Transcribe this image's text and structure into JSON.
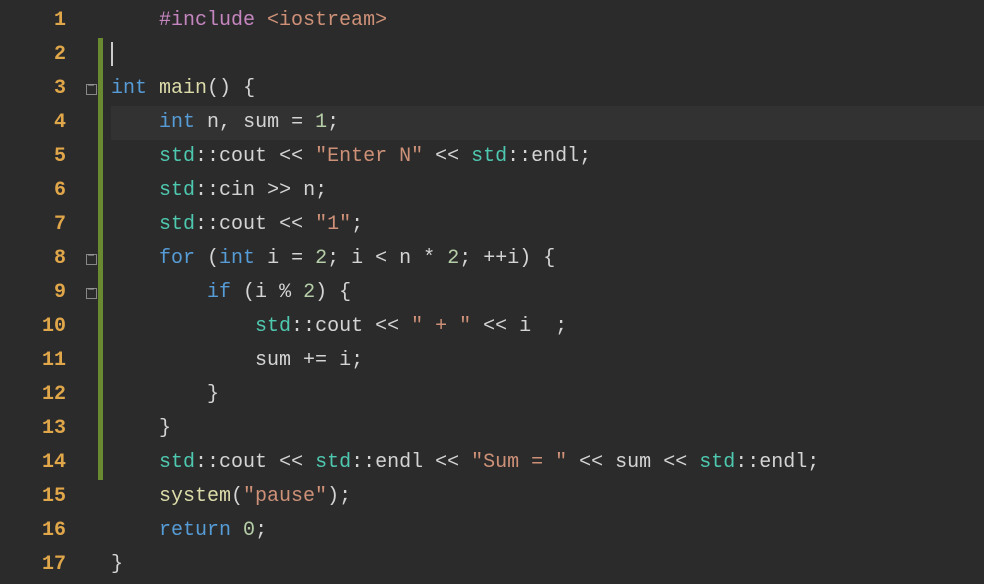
{
  "lines": {
    "n1": "1",
    "n2": "2",
    "n3": "3",
    "n4": "4",
    "n5": "5",
    "n6": "6",
    "n7": "7",
    "n8": "8",
    "n9": "9",
    "n10": "10",
    "n11": "11",
    "n12": "12",
    "n13": "13",
    "n14": "14",
    "n15": "15",
    "n16": "16",
    "n17": "17"
  },
  "code": {
    "l1_pp": "#include",
    "l1_inc": "<iostream>",
    "l3_type": "int",
    "l3_fn": "main",
    "l3_paren": "()",
    "l3_brace": " {",
    "l4_type": "int",
    "l4_id1": " n",
    "l4_comma": ", ",
    "l4_id2": "sum ",
    "l4_eq": "= ",
    "l4_num": "1",
    "l4_semi": ";",
    "l5_ns1": "std",
    "l5_dcolon1": "::",
    "l5_cout": "cout",
    "l5_op1": " << ",
    "l5_str": "\"Enter N\"",
    "l5_op2": " << ",
    "l5_ns2": "std",
    "l5_dcolon2": "::",
    "l5_endl": "endl",
    "l5_semi": ";",
    "l6_ns": "std",
    "l6_dcolon": "::",
    "l6_cin": "cin",
    "l6_op": " >> ",
    "l6_id": "n",
    "l6_semi": ";",
    "l7_ns": "std",
    "l7_dcolon": "::",
    "l7_cout": "cout",
    "l7_op": " << ",
    "l7_str": "\"1\"",
    "l7_semi": ";",
    "l8_for": "for",
    "l8_open": " (",
    "l8_type": "int",
    "l8_id1": " i ",
    "l8_eq": "= ",
    "l8_num1": "2",
    "l8_semi1": "; ",
    "l8_id2": "i ",
    "l8_lt": "< ",
    "l8_id3": "n ",
    "l8_mul": "* ",
    "l8_num2": "2",
    "l8_semi2": "; ",
    "l8_inc": "++",
    "l8_id4": "i",
    "l8_close": ") {",
    "l9_if": "if",
    "l9_open": " (",
    "l9_id": "i ",
    "l9_mod": "% ",
    "l9_num": "2",
    "l9_close": ") {",
    "l10_ns": "std",
    "l10_dcolon": "::",
    "l10_cout": "cout",
    "l10_op1": " << ",
    "l10_str": "\" + \"",
    "l10_op2": " << ",
    "l10_id": "i  ",
    "l10_semi": ";",
    "l11_id1": "sum ",
    "l11_pluseq": "+= ",
    "l11_id2": "i",
    "l11_semi": ";",
    "l12_brace": "}",
    "l13_brace": "}",
    "l14_ns1": "std",
    "l14_dcolon1": "::",
    "l14_cout": "cout",
    "l14_op1": " << ",
    "l14_ns2": "std",
    "l14_dcolon2": "::",
    "l14_endl1": "endl",
    "l14_op2": " << ",
    "l14_str": "\"Sum = \"",
    "l14_op3": " << ",
    "l14_id": "sum",
    "l14_op4": " << ",
    "l14_ns3": "std",
    "l14_dcolon3": "::",
    "l14_endl2": "endl",
    "l14_semi": ";",
    "l15_fn": "system",
    "l15_open": "(",
    "l15_str": "\"pause\"",
    "l15_close": ")",
    "l15_semi": ";",
    "l16_kw": "return",
    "l16_sp": " ",
    "l16_num": "0",
    "l16_semi": ";",
    "l17_brace": "}"
  }
}
